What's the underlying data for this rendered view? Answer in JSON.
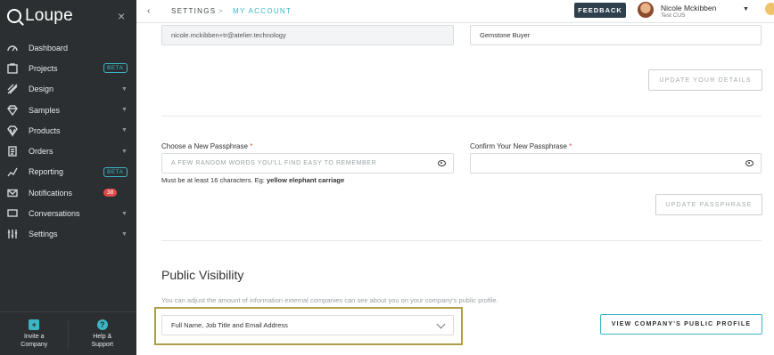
{
  "app": {
    "name": "Loupe",
    "close_glyph": "×"
  },
  "sidebar": {
    "items": [
      {
        "label": "Dashboard",
        "icon": "dashboard-icon"
      },
      {
        "label": "Projects",
        "icon": "projects-icon",
        "badge": "BETA"
      },
      {
        "label": "Design",
        "icon": "design-icon",
        "caret": "▼"
      },
      {
        "label": "Samples",
        "icon": "samples-icon",
        "caret": "▼"
      },
      {
        "label": "Products",
        "icon": "products-icon",
        "caret": "▼"
      },
      {
        "label": "Orders",
        "icon": "orders-icon",
        "caret": "▼"
      },
      {
        "label": "Reporting",
        "icon": "reporting-icon",
        "badge": "BETA"
      },
      {
        "label": "Notifications",
        "icon": "notifications-icon",
        "count": "38"
      },
      {
        "label": "Conversations",
        "icon": "conversations-icon",
        "caret": "▼"
      },
      {
        "label": "Settings",
        "icon": "settings-icon",
        "caret": "▼"
      }
    ],
    "bottom": {
      "invite_line1": "Invite a",
      "invite_line2": "Company",
      "help_line1": "Help &",
      "help_line2": "Support"
    }
  },
  "topbar": {
    "back": "‹",
    "crumb_1": "SETTINGS",
    "crumb_sep": ">",
    "crumb_2": "MY ACCOUNT",
    "feedback": "FEEDBACK",
    "user_name": "Nicole Mckibben",
    "user_sub": "Test CUS",
    "caret": "▼"
  },
  "details": {
    "email_value": "nicole.mckibben+tr@atelier.technology",
    "job_title_value": "Gemstone Buyer",
    "update_details": "UPDATE YOUR DETAILS"
  },
  "passphrase": {
    "new_label": "Choose a New Passphrase",
    "confirm_label": "Confirm Your New Passphrase",
    "required_mark": "*",
    "new_placeholder": "A FEW RANDOM WORDS YOU'LL FIND EASY TO REMEMBER",
    "confirm_placeholder": "",
    "hint_prefix": "Must be at least 16 characters. Eg:",
    "hint_example": "yellow elephant carriage",
    "update_button": "UPDATE PASSPHRASE"
  },
  "visibility": {
    "title": "Public Visibility",
    "description": "You can adjust the amount of information external companies can see about you on your company's public profile.",
    "selected": "Full Name, Job Title and Email Address",
    "view_button": "VIEW COMPANY'S PUBLIC PROFILE"
  },
  "colors": {
    "sidebar_bg": "#2b2f31",
    "accent": "#3bb6c4",
    "badge_red": "#e24b4b",
    "feedback_bg": "#2e3f4d",
    "highlight": "#ad9d48"
  }
}
